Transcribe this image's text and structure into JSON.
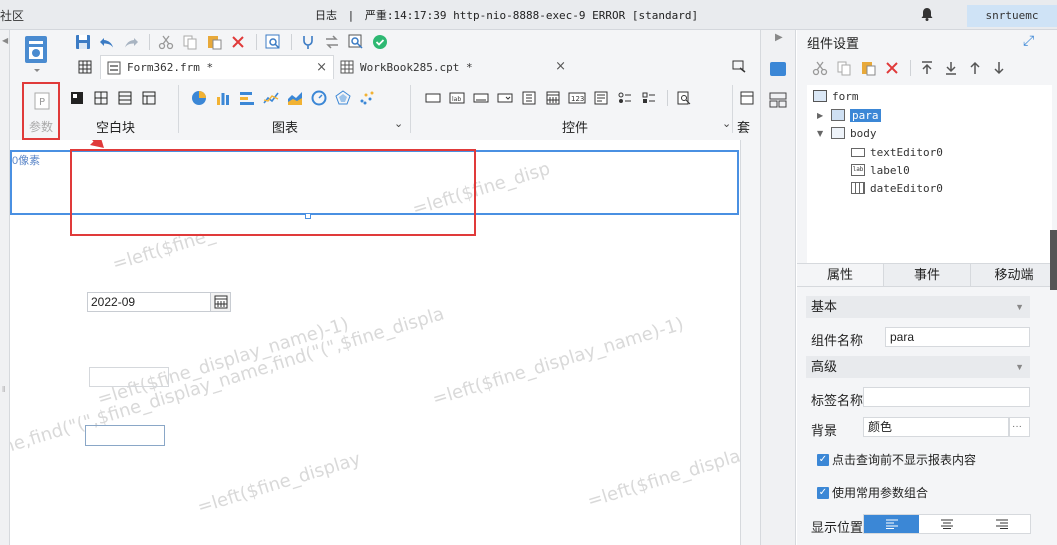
{
  "topbar": {
    "community": "社区",
    "log_label": "日志",
    "log_sep": "|",
    "log_message": "严重:14:17:39 http-nio-8888-exec-9 ERROR [standard]",
    "user": "snrtuemc"
  },
  "tabs": [
    {
      "label": "Form362.frm *",
      "close": "×",
      "active": true
    },
    {
      "label": "WorkBook285.cpt *",
      "close": "×",
      "active": false
    }
  ],
  "params": {
    "label": "参数"
  },
  "groups": {
    "blank": {
      "label": "空白块"
    },
    "chart": {
      "label": "图表",
      "chevron": "⌄"
    },
    "widget": {
      "label": "控件",
      "chevron": "⌄"
    },
    "preset": {
      "label": "套用"
    }
  },
  "canvas": {
    "ruler_label": "0像素",
    "date_value": "2022-09",
    "watermark_1": "=left($fine_disp",
    "watermark_2": "=left($fine_",
    "watermark_3": "=left($fine_display_name)-1)",
    "watermark_4": "=left($fine_display_name)-1)",
    "watermark_5": "ne,find(\"(\",$fine_display_name,find(\"(\",$fine_displa",
    "watermark_6": "=left($fine_display",
    "watermark_7": "=left($fine_displa"
  },
  "right_panel": {
    "title": "组件设置",
    "tree": {
      "form": "form",
      "para": "para",
      "body": "body",
      "children": [
        "textEditor0",
        "label0",
        "dateEditor0"
      ]
    },
    "tabs": [
      "属性",
      "事件",
      "移动端"
    ],
    "section_basic": "基本",
    "component_name_label": "组件名称",
    "component_name_value": "para",
    "section_advanced": "高级",
    "tag_name_label": "标签名称",
    "tag_name_value": "",
    "background_label": "背景",
    "background_value": "颜色",
    "background_more": "···",
    "check_1": "点击查询前不显示报表内容",
    "check_2": "使用常用参数组合",
    "display_position_label": "显示位置"
  },
  "colors": {
    "accent": "#3b87d6",
    "highlight_red": "#e03a3a"
  }
}
